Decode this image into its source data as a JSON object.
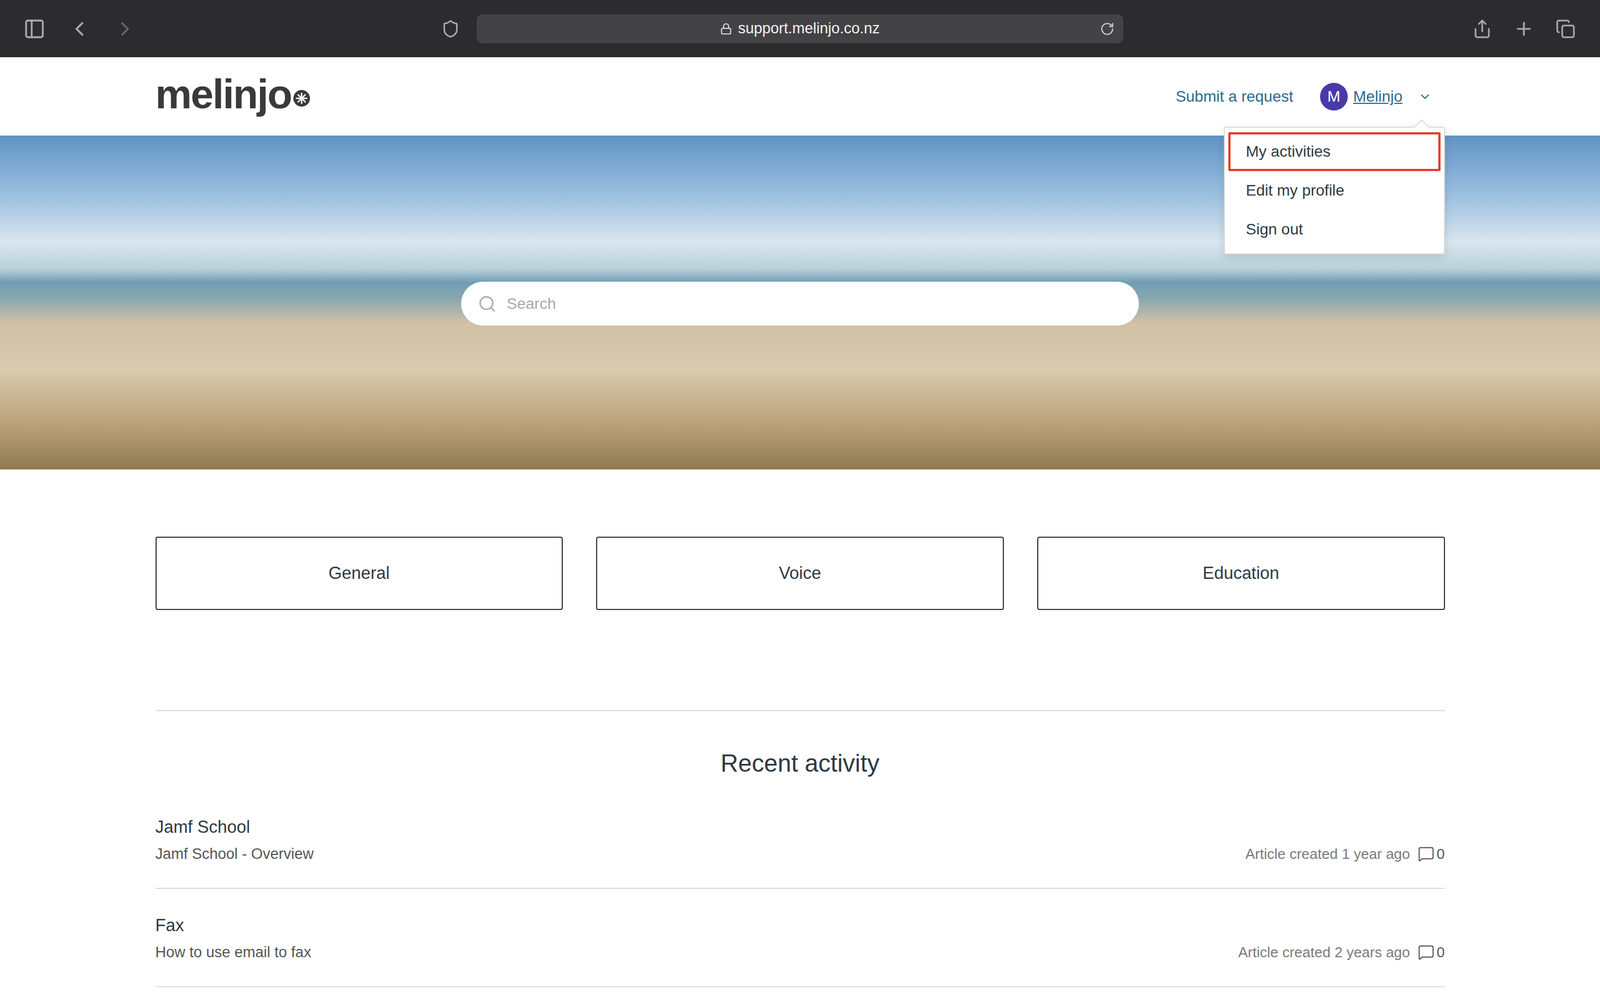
{
  "browser": {
    "url": "support.melinjo.co.nz"
  },
  "header": {
    "logo": "melinjo",
    "submit_request": "Submit a request",
    "user": {
      "initial": "M",
      "name": "Melinjo"
    }
  },
  "user_menu": {
    "items": [
      {
        "label": "My activities",
        "highlighted": true
      },
      {
        "label": "Edit my profile",
        "highlighted": false
      },
      {
        "label": "Sign out",
        "highlighted": false
      }
    ]
  },
  "search": {
    "placeholder": "Search"
  },
  "categories": [
    "General",
    "Voice",
    "Education"
  ],
  "recent_activity": {
    "title": "Recent activity",
    "items": [
      {
        "title": "Jamf School",
        "subtitle": "Jamf School - Overview",
        "meta": "Article created 1 year ago",
        "comments": "0"
      },
      {
        "title": "Fax",
        "subtitle": "How to use email to fax",
        "meta": "Article created 2 years ago",
        "comments": "0"
      }
    ]
  }
}
